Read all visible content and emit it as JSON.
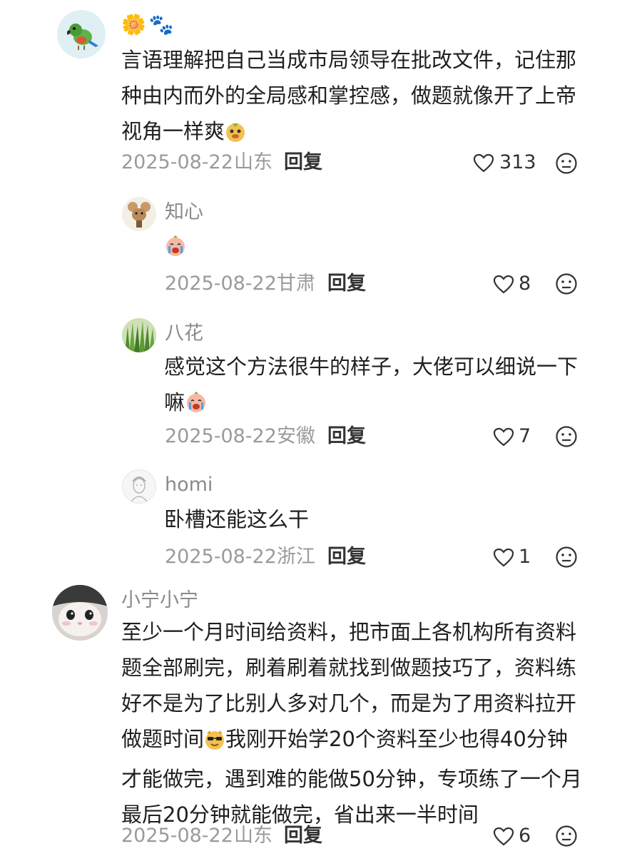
{
  "comments": [
    {
      "username": "",
      "username_emoji": [
        "🌼",
        "🐾"
      ],
      "lines": [
        "言语理解把自己当成市局领导在批改文件，记住那",
        "种由内而外的全局感和掌控感，做题就像开了上帝",
        "视角一样爽"
      ],
      "inline_emoji": "doge-emoji",
      "date": "2025-08-22",
      "location": "山东",
      "reply_label": "回复",
      "likes": "313",
      "replies": [
        {
          "username": "知心",
          "lines": [
            ""
          ],
          "inline_emoji": "crying-emoji",
          "date": "2025-08-22",
          "location": "甘肃",
          "reply_label": "回复",
          "likes": "8"
        },
        {
          "username": "八花",
          "lines": [
            "感觉这个方法很牛的样子，大佬可以细说一下",
            "嘛"
          ],
          "inline_emoji": "crying-emoji",
          "date": "2025-08-22",
          "location": "安徽",
          "reply_label": "回复",
          "likes": "7"
        },
        {
          "username": "homi",
          "lines": [
            "卧槽还能这么干"
          ],
          "date": "2025-08-22",
          "location": "浙江",
          "reply_label": "回复",
          "likes": "1"
        }
      ]
    },
    {
      "username": "小宁小宁",
      "lines": [
        "至少一个月时间给资料，把市面上各机构所有资料",
        "题全部刷完，刷着刷着就找到做题技巧了，资料练",
        "好不是为了比别人多对几个，而是为了用资料拉开",
        "做题时间",
        "我刚开始学20个资料至少也得40分钟",
        "才能做完，遇到难的能做50分钟，专项练了一个月",
        "最后20分钟就能做完，省出来一半时间"
      ],
      "inline_emoji": "cool-emoji",
      "date": "2025-08-22",
      "location": "山东",
      "reply_label": "回复",
      "likes": "6"
    }
  ]
}
